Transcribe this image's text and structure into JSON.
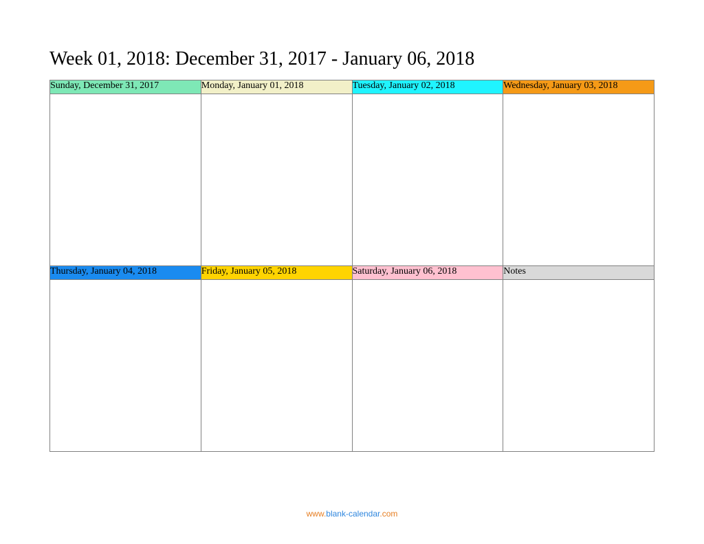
{
  "title": "Week 01, 2018: December 31, 2017 - January 06, 2018",
  "cells": {
    "row1": [
      {
        "label": "Sunday, December 31, 2017",
        "bg": "#7ee8b6"
      },
      {
        "label": "Monday, January 01, 2018",
        "bg": "#f2f0c8"
      },
      {
        "label": "Tuesday, January 02, 2018",
        "bg": "#20f4ff"
      },
      {
        "label": "Wednesday, January 03, 2018",
        "bg": "#f59a17"
      }
    ],
    "row2": [
      {
        "label": "Thursday, January 04, 2018",
        "bg": "#1a8bf0"
      },
      {
        "label": "Friday, January 05, 2018",
        "bg": "#ffd400"
      },
      {
        "label": "Saturday, January 06, 2018",
        "bg": "#ffc1d0"
      },
      {
        "label": "Notes",
        "bg": "#d9d9d9"
      }
    ]
  },
  "footer": {
    "p1": "www.",
    "p2": "blank-calendar",
    "p3": ".com"
  }
}
